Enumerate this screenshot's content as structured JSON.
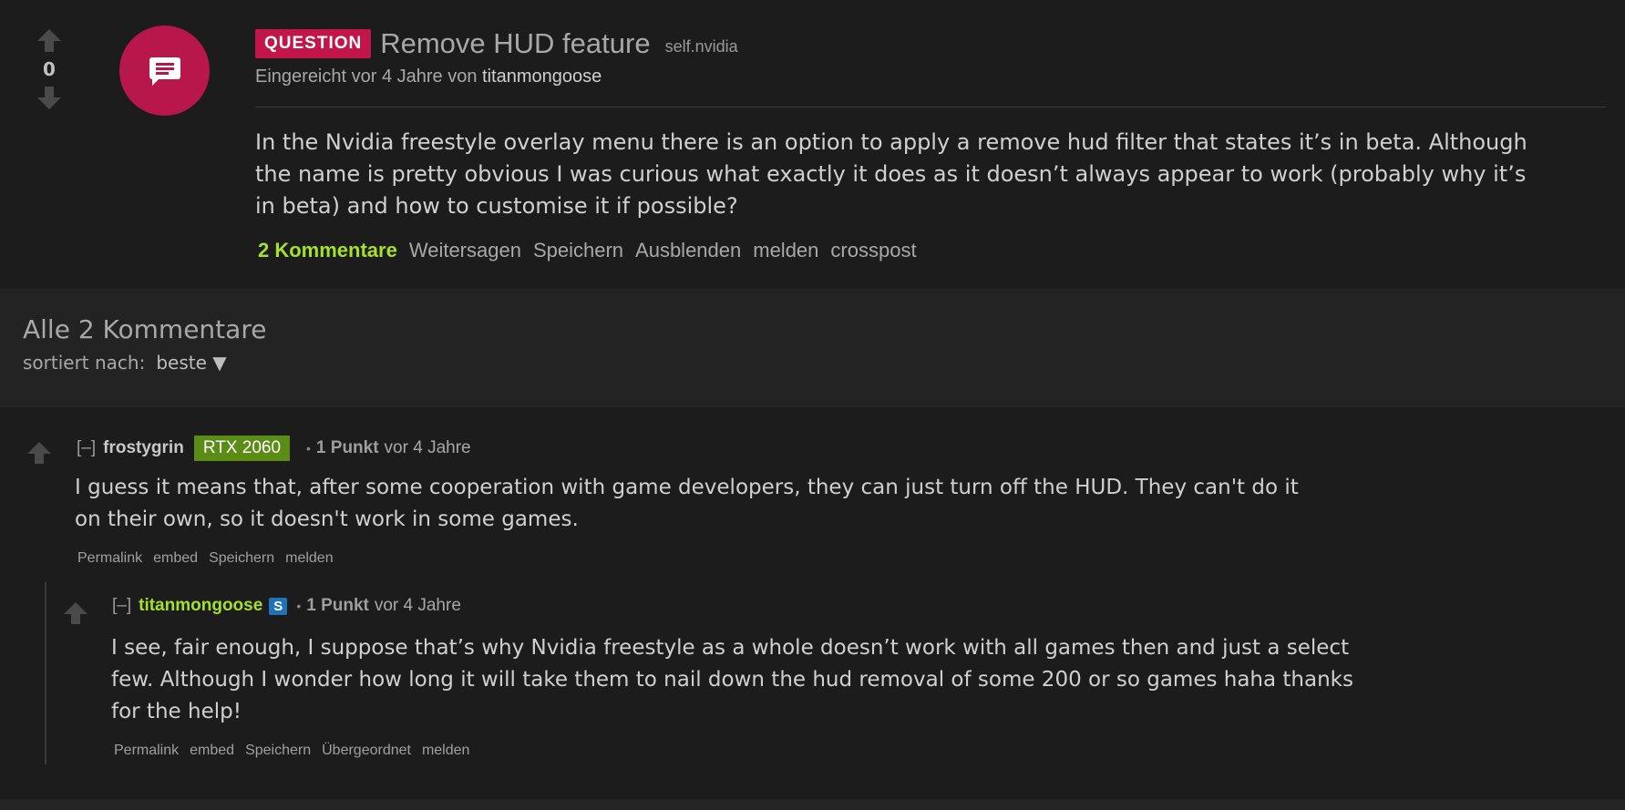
{
  "post": {
    "score": "0",
    "flair": "QUESTION",
    "title": "Remove HUD feature",
    "domain": "self.nvidia",
    "submitted_prefix": "Eingereicht vor 4 Jahre von ",
    "author": "titanmongoose",
    "selftext_lines": [
      "In the Nvidia freestyle overlay menu there is an option to apply a remove hud filter that states it’s in beta. Although",
      "the name is pretty obvious I was curious what exactly it does as it doesn’t always appear to work (probably why it’s",
      "in beta) and how to customise it if possible?"
    ],
    "actions": {
      "comments": "2 Kommentare",
      "share": "Weitersagen",
      "save": "Speichern",
      "hide": "Ausblenden",
      "report": "melden",
      "crosspost": "crosspost"
    }
  },
  "comments_section": {
    "title": "Alle 2 Kommentare",
    "sort_label": "sortiert nach:",
    "sort_value": "beste ▼"
  },
  "comments": [
    {
      "toggle": "[–]",
      "author": "frostygrin",
      "user_flair": "RTX 2060",
      "points": "1 Punkt",
      "time": "vor 4 Jahre",
      "body_lines": [
        "I guess it means that, after some cooperation with game developers, they can just turn off the HUD. They can't do it",
        "on their own, so it doesn't work in some games."
      ],
      "actions": {
        "permalink": "Permalink",
        "embed": "embed",
        "save": "Speichern",
        "report": "melden"
      }
    },
    {
      "toggle": "[–]",
      "author": "titanmongoose",
      "badge": "S",
      "points": "1 Punkt",
      "time": "vor 4 Jahre",
      "body_lines": [
        "I see, fair enough, I suppose that’s why Nvidia freestyle as a whole doesn’t work with all games then and just a select",
        "few. Although I wonder how long it will take them to nail down the hud removal of some 200 or so games haha thanks",
        "for the help!"
      ],
      "actions": {
        "permalink": "Permalink",
        "embed": "embed",
        "save": "Speichern",
        "parent": "Übergeordnet",
        "report": "melden"
      }
    }
  ],
  "colors": {
    "flair_bg": "#c2164a",
    "thumbnail_bg": "#b8174b",
    "comments_link": "#a4e02c",
    "user_flair_bg": "#5a8c16",
    "sub_badge_bg": "#1e73b8"
  },
  "icons": [
    "upvote-arrow-icon",
    "downvote-arrow-icon",
    "chat-bubble-icon"
  ]
}
